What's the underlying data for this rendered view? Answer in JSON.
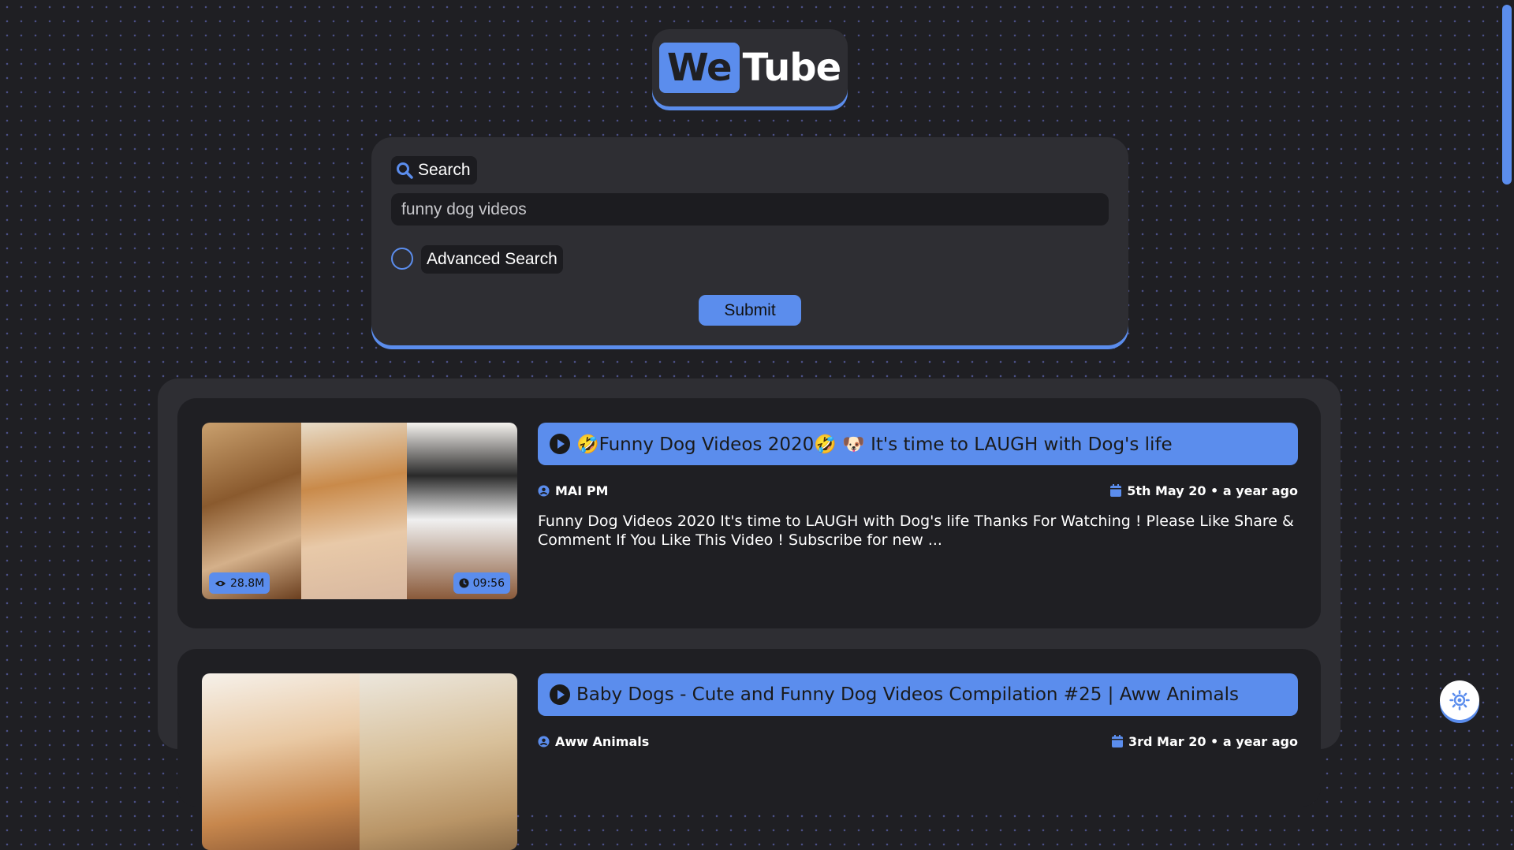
{
  "logo": {
    "part1": "We",
    "part2": "Tube"
  },
  "search": {
    "label": "Search",
    "value": "funny dog videos",
    "advanced_label": "Advanced Search",
    "submit_label": "Submit"
  },
  "results": [
    {
      "title": "🤣Funny Dog Videos 2020🤣 🐶 It's time to LAUGH with Dog's life",
      "channel": "MAI PM",
      "date": "5th May 20 • a year ago",
      "description": "Funny Dog Videos 2020 It's time to LAUGH with Dog's life Thanks For Watching ! Please Like Share & Comment If You Like This Video ! Subscribe for new ...",
      "views": "28.8M",
      "duration": "09:56"
    },
    {
      "title": "Baby Dogs - Cute and Funny Dog Videos Compilation #25 | Aww Animals",
      "channel": "Aww Animals",
      "date": "3rd Mar 20 • a year ago"
    }
  ],
  "colors": {
    "accent": "#5b8ded",
    "background": "#1f1f23",
    "panel": "#2e2e33"
  }
}
